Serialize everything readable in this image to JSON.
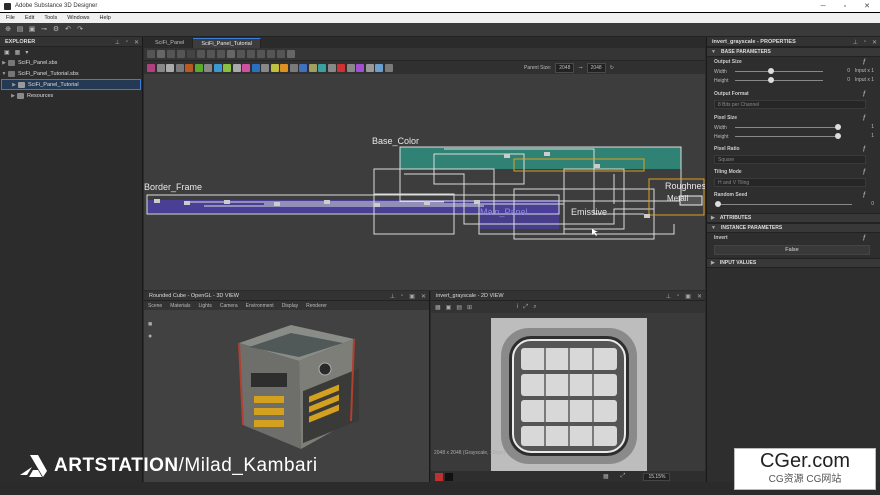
{
  "window": {
    "title": "Adobe Substance 3D Designer",
    "minimize": "─",
    "maximize": "▫",
    "close": "✕"
  },
  "menu": [
    "File",
    "Edit",
    "Tools",
    "Windows",
    "Help"
  ],
  "explorer": {
    "title": "EXPLORER",
    "items": [
      {
        "label": "SciFi_Panel.sbs",
        "level": 0
      },
      {
        "label": "SciFi_Panel_Tutorial.sbs",
        "level": 0
      },
      {
        "label": "SciFi_Panel_Tutorial",
        "level": 1,
        "selected": true
      },
      {
        "label": "Resources",
        "level": 1
      }
    ]
  },
  "graph": {
    "tabs": [
      "SciFi_Panel",
      "SciFi_Panel_Tutorial"
    ],
    "parent_size_label": "Parent Size:",
    "parent_size_value": "2048",
    "size_value": "2048",
    "frames": {
      "base_color": "Base_Color",
      "border_frame": "Border_Frame",
      "main_panel": "Main_Panel",
      "emissive": "Emissive",
      "roughness": "Roughnes",
      "metal": "Metall"
    }
  },
  "view3d": {
    "title": "Rounded Cube - OpenGL - 3D VIEW",
    "menu": [
      "Scene",
      "Materials",
      "Lights",
      "Camera",
      "Environment",
      "Display",
      "Renderer"
    ]
  },
  "view2d": {
    "title": "invert_grayscale - 2D VIEW",
    "status": "2048 x 2048 (Grayscale, 16bpc)",
    "zoom": "15.15%"
  },
  "properties": {
    "title": "invert_grayscale - PROPERTIES",
    "base_parameters": "BASE PARAMETERS",
    "output_size": "Output Size",
    "width_label": "Width",
    "height_label": "Height",
    "width_value": "0",
    "height_value": "0",
    "width_rel": "Input x 1",
    "height_rel": "Input x 1",
    "output_format": "Output Format",
    "output_format_value": "8 Bits per Channel",
    "pixel_size": "Pixel Size",
    "pixel_width_value": "1",
    "pixel_height_value": "1",
    "pixel_ratio": "Pixel Ratio",
    "pixel_ratio_value": "Square",
    "tiling_mode": "Tiling Mode",
    "tiling_mode_value": "H and V Tiling",
    "random_seed": "Random Seed",
    "random_seed_value": "0",
    "attributes": "ATTRIBUTES",
    "instance_parameters": "INSTANCE PARAMETERS",
    "invert": "Invert",
    "invert_value": "False",
    "input_values": "INPUT VALUES"
  },
  "watermark": {
    "brand": "ARTSTATION",
    "author": "/Milad_Kambari"
  },
  "cger": {
    "big": "CGer.com",
    "small": "CG资源 CG网站"
  },
  "colors": {
    "accent": "#3b7bd9",
    "base_color_frame": "#2e8a7a",
    "border_frame": "#4a3f9e",
    "emissive_frame": "#e0a020"
  }
}
